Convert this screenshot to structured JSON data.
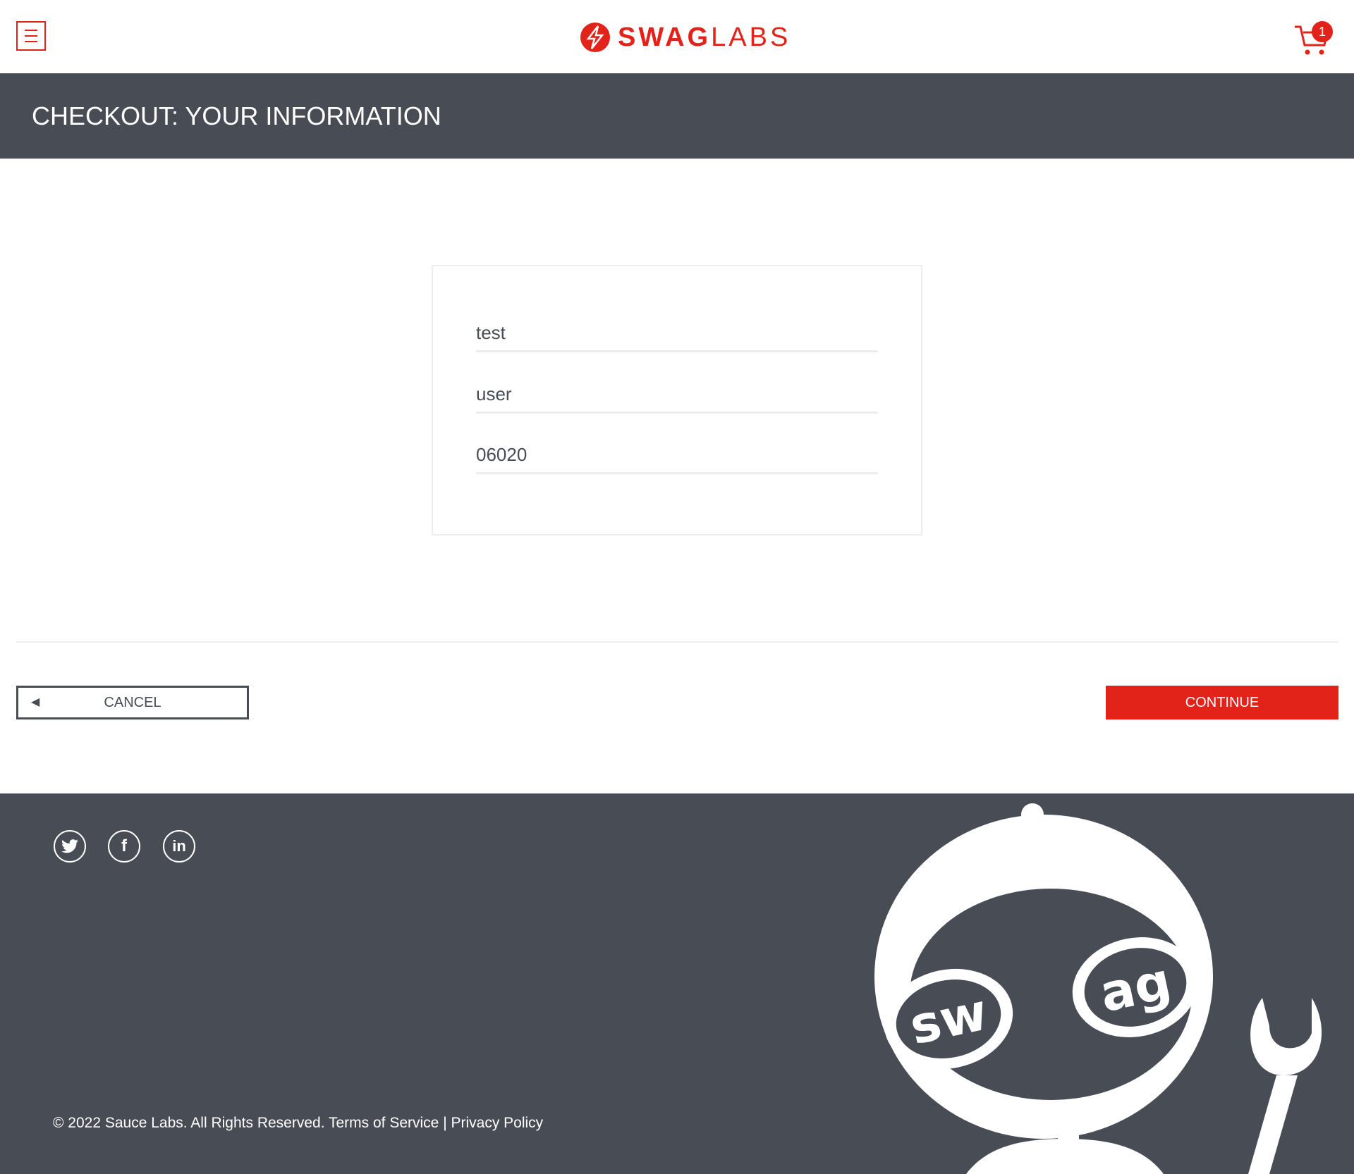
{
  "header": {
    "logo": {
      "bold": "SWAG",
      "light": "LABS"
    },
    "cart_count": "1",
    "icons": {
      "menu": "hamburger-menu-icon",
      "cart": "shopping-cart-icon",
      "logo": "lightning-bolt-logo-icon"
    }
  },
  "page_title": "CHECKOUT: YOUR INFORMATION",
  "form": {
    "first_name": "test",
    "last_name": "user",
    "postal_code": "06020"
  },
  "actions": {
    "cancel_label": "CANCEL",
    "cancel_icon": "back-arrow-icon",
    "continue_label": "CONTINUE"
  },
  "footer": {
    "social": [
      "twitter-icon",
      "facebook-icon",
      "linkedin-icon"
    ],
    "copyright": "© 2022 Sauce Labs. All Rights Reserved. Terms of Service | Privacy Policy",
    "robot_text": "swag"
  },
  "colors": {
    "accent": "#e2231a",
    "dark": "#484c55",
    "border": "#ededed"
  }
}
